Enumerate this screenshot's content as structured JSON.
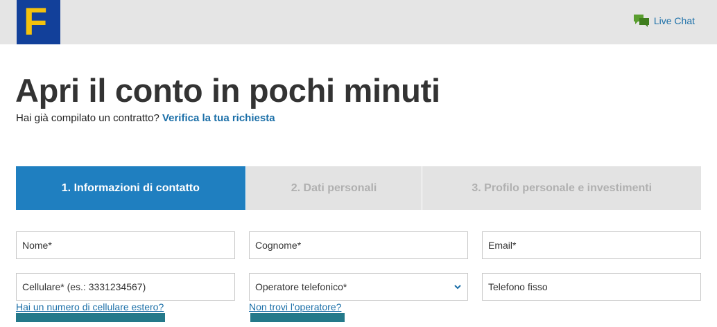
{
  "header": {
    "logo_letter": "F",
    "live_chat_label": "Live Chat"
  },
  "page": {
    "title": "Apri il conto in pochi minuti",
    "subtitle_text": "Hai già compilato un contratto? ",
    "subtitle_link": "Verifica la tua richiesta"
  },
  "steps": [
    {
      "label": "1. Informazioni di contatto",
      "active": true
    },
    {
      "label": "2. Dati personali",
      "active": false
    },
    {
      "label": "3. Profilo personale e investimenti",
      "active": false
    }
  ],
  "form": {
    "nome_placeholder": "Nome*",
    "cognome_placeholder": "Cognome*",
    "email_placeholder": "Email*",
    "cellulare_placeholder": "Cellulare* (es.: 3331234567)",
    "operatore_selected": "Operatore telefonico*",
    "fisso_placeholder": "Telefono fisso",
    "cell_help_link": "Hai un numero di cellulare estero?",
    "oper_help_link": "Non trovi l'operatore?"
  },
  "colors": {
    "logo_bg": "#12409a",
    "logo_fg": "#f4c20d",
    "accent_blue": "#1f7fc0",
    "link_blue": "#1b6fa8",
    "chat_green": "#5a9e2f",
    "teal_bar": "#24798a"
  },
  "icons": {
    "chat": "chat-bubbles-icon",
    "select_chevron": "chevron-down-icon"
  }
}
